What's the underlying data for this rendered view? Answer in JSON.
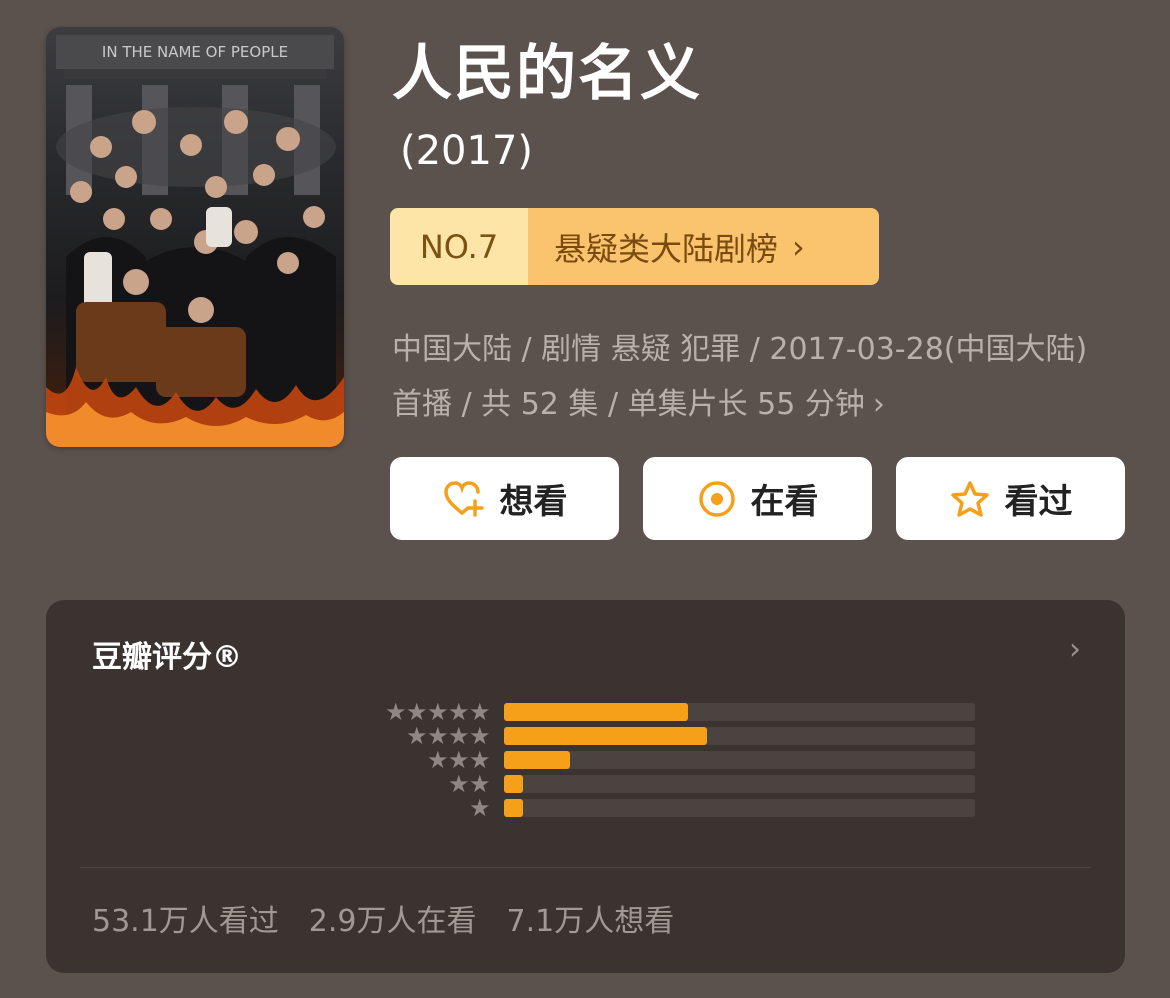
{
  "show": {
    "title": "人民的名义",
    "year": "(2017)",
    "poster_text": "IN THE NAME OF PEOPLE"
  },
  "rank": {
    "number": "NO.7",
    "list_label": "悬疑类大陆剧榜",
    "chevron": "›"
  },
  "info": {
    "line": "中国大陆 / 剧情 悬疑 犯罪 / 2017-03-28(中国大陆) 首播 / 共 52 集 / 单集片长 55 分钟",
    "chevron": "›"
  },
  "actions": {
    "want": "想看",
    "watching": "在看",
    "watched": "看过",
    "icons": [
      "heart-plus-icon",
      "target-circle-icon",
      "star-outline-icon"
    ],
    "icon_color": "#f6a01a"
  },
  "rating_card": {
    "title": "豆瓣评分®",
    "chevron": "›",
    "chart_data": {
      "type": "bar",
      "categories": [
        "5 stars",
        "4 stars",
        "3 stars",
        "2 stars",
        "1 star"
      ],
      "values": [
        39,
        43,
        14,
        4,
        4
      ],
      "orientation": "horizontal"
    },
    "stats": {
      "watched": "53.1万人看过",
      "watching": "2.9万人在看",
      "want": "7.1万人想看"
    }
  },
  "colors": {
    "background": "#5b514d",
    "card": "#3a3330",
    "bar_fill": "#f6a01a",
    "rank_left": "#fde5a8",
    "rank_right": "#f9c46d"
  }
}
